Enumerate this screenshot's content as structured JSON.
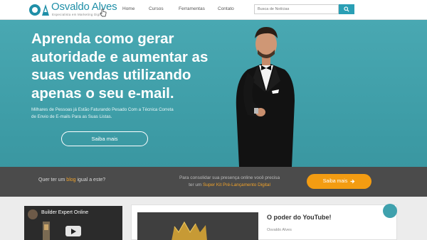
{
  "header": {
    "logo_name": "Osvaldo Alves",
    "logo_tagline": "Especialista em Marketing Digital",
    "nav": [
      "Home",
      "Cursos",
      "Ferramentas",
      "Contato"
    ],
    "search_placeholder": "Busca de Notícias",
    "search_icon": "search-icon"
  },
  "hero": {
    "title": "Aprenda como gerar autoridade e aumentar as suas vendas utilizando apenas o seu e-mail.",
    "subtitle": "Milhares de Pessoas já Estão Faturando Pesado Com a Técnica Correta de Envio de E-mails Para as Suas Listas.",
    "button": "Saiba mais"
  },
  "band": {
    "question_pre": "Quer ter um ",
    "question_hl": "blog",
    "question_post": " igual a este?",
    "mid_line1": "Para consolidar sua presença online você precisa",
    "mid_pre": "ter um ",
    "mid_hl": "Super Kit Pré-Lançamento",
    "mid_post": " Digital",
    "button": "Saiba mais"
  },
  "video": {
    "title": "Builder Expert Online"
  },
  "post": {
    "title": "O poder do YouTube!",
    "author": "Osvaldo Alves"
  },
  "colors": {
    "accent": "#2a9fb5",
    "hero_bg": "#45a3ad",
    "band_bg": "#4b4b4b",
    "orange": "#f39c12"
  }
}
